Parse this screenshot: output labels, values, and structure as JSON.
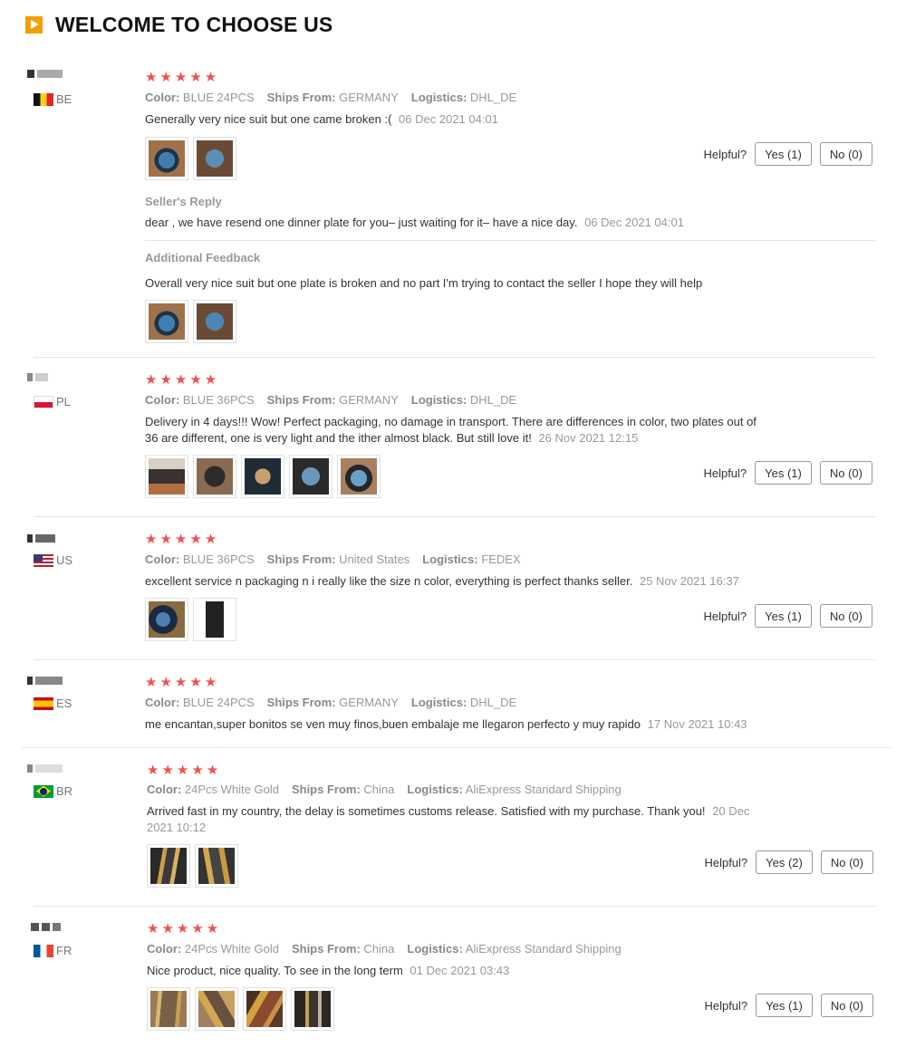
{
  "header": {
    "title": "WELCOME TO CHOOSE US",
    "icon": "play-icon"
  },
  "labels": {
    "color": "Color:",
    "ships_from": "Ships From:",
    "logistics": "Logistics:",
    "helpful": "Helpful?",
    "seller_reply": "Seller's Reply",
    "additional_feedback": "Additional Feedback",
    "stars": "★★★★★"
  },
  "reviews": [
    {
      "country": "BE",
      "rating": 5,
      "color": "BLUE 24PCS",
      "ships_from": "GERMANY",
      "logistics": "DHL_DE",
      "text": "Generally very nice suit but one came broken :(",
      "date": "06 Dec 2021 04:01",
      "yes": "Yes (1)",
      "no": "No (0)",
      "seller_reply": {
        "text": "dear , we have resend one dinner plate for you– just waiting for it– have a nice day.",
        "date": "06 Dec 2021 04:01"
      },
      "additional_feedback": {
        "text": "Overall very nice suit but one plate is broken and no part I'm trying to contact the seller I hope they will help"
      }
    },
    {
      "country": "PL",
      "rating": 5,
      "color": "BLUE 36PCS",
      "ships_from": "GERMANY",
      "logistics": "DHL_DE",
      "text_line1": "Delivery in 4 days!!! Wow! Perfect packaging, no damage in transport. There are differences in color, two plates out of",
      "text_line2": "36 are different, one is very light and the ither almost black. But still love it!",
      "date": "26 Nov 2021 12:15",
      "yes": "Yes (1)",
      "no": "No (0)"
    },
    {
      "country": "US",
      "rating": 5,
      "color": "BLUE 36PCS",
      "ships_from": "United States",
      "logistics": "FEDEX",
      "text": "excellent service n packaging n i really like the size n color, everything is perfect thanks seller.",
      "date": "25 Nov 2021 16:37",
      "yes": "Yes (1)",
      "no": "No (0)"
    },
    {
      "country": "ES",
      "rating": 5,
      "color": "BLUE 24PCS",
      "ships_from": "GERMANY",
      "logistics": "DHL_DE",
      "text": "me encantan,super bonitos se ven muy finos,buen embalaje me llegaron perfecto y muy rapido",
      "date": "17 Nov 2021 10:43"
    },
    {
      "country": "BR",
      "rating": 5,
      "color": "24Pcs White Gold",
      "ships_from": "China",
      "logistics": "AliExpress Standard Shipping",
      "text": "Arrived fast in my country, the delay is sometimes customs release. Satisfied with my purchase. Thank you!",
      "date_line1": "20 Dec",
      "date_line2": "2021 10:12",
      "yes": "Yes (2)",
      "no": "No (0)"
    },
    {
      "country": "FR",
      "rating": 5,
      "color": "24Pcs White Gold",
      "ships_from": "China",
      "logistics": "AliExpress Standard Shipping",
      "text": "Nice product, nice quality. To see in the long term",
      "date": "01 Dec 2021 03:43",
      "yes": "Yes (1)",
      "no": "No (0)"
    }
  ],
  "colors": {
    "star": "#f05050",
    "accent": "#f0a000",
    "muted": "#999999"
  }
}
